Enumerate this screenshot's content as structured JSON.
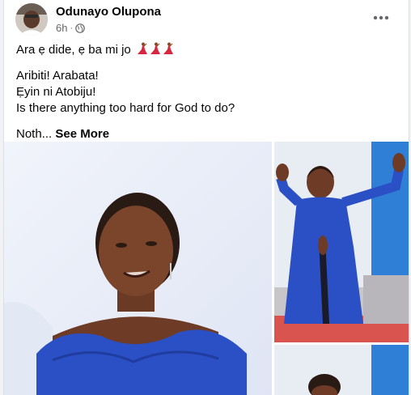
{
  "post": {
    "author": "Odunayo Olupona",
    "time": "6h",
    "separator": "·",
    "privacy_icon": "globe-icon",
    "more_icon": "more-options-icon",
    "lines": [
      "Ara ẹ dide, ẹ ba mi jo",
      "Aribiti! Arabata!",
      "Ẹyin ni Atobiju!",
      "Is there anything too hard for God to do?"
    ],
    "truncated_text": "Noth...",
    "see_more": "See More",
    "emoji": "dancer-emoji"
  },
  "photos": [
    {
      "name": "main-photo",
      "desc": "woman in blue off-shoulder dress, close-up"
    },
    {
      "name": "side-photo-top",
      "desc": "woman in blue gown with raised hands"
    },
    {
      "name": "side-photo-bottom",
      "desc": "woman portrait"
    }
  ],
  "colors": {
    "dress_blue": "#2b4fc4",
    "wall": "#e9edf8",
    "accent_text": "#050505",
    "meta_text": "#65676b"
  }
}
